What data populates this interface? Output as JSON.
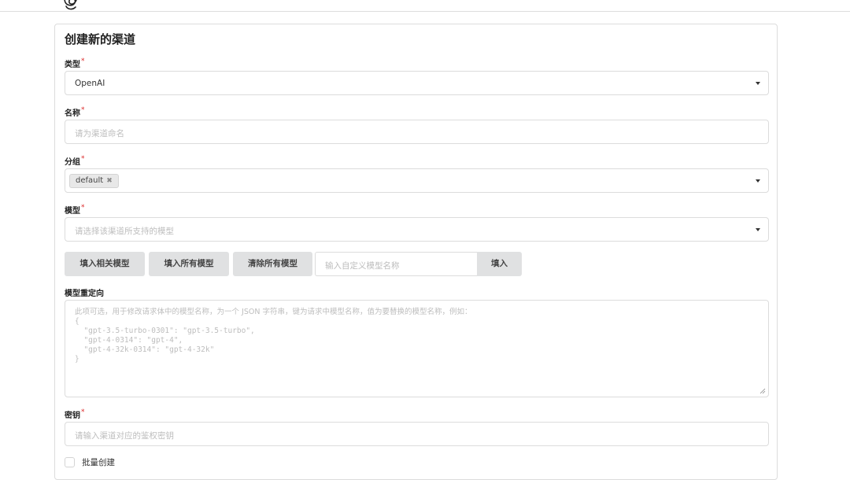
{
  "header": {
    "logo_icon": "logo-icon"
  },
  "form": {
    "title": "创建新的渠道",
    "type": {
      "label": "类型",
      "required": "*",
      "value": "OpenAI"
    },
    "name": {
      "label": "名称",
      "required": "*",
      "placeholder": "请为渠道命名"
    },
    "group": {
      "label": "分组",
      "required": "*",
      "chip": "default",
      "chip_remove": "✖"
    },
    "models": {
      "label": "模型",
      "required": "*",
      "placeholder": "请选择该渠道所支持的模型"
    },
    "model_buttons": {
      "fill_related": "填入相关模型",
      "fill_all": "填入所有模型",
      "clear_all": "清除所有模型",
      "custom_placeholder": "输入自定义模型名称",
      "fill": "填入"
    },
    "model_mapping": {
      "label": "模型重定向",
      "placeholder_line1": "此项可选，用于修改请求体中的模型名称，为一个 JSON 字符串，键为请求中模型名称，值为要替换的模型名称，例如：",
      "placeholder_rest": "{\n  \"gpt-3.5-turbo-0301\": \"gpt-3.5-turbo\",\n  \"gpt-4-0314\": \"gpt-4\",\n  \"gpt-4-32k-0314\": \"gpt-4-32k\"\n}"
    },
    "key": {
      "label": "密钥",
      "required": "*",
      "placeholder": "请输入渠道对应的鉴权密钥"
    },
    "batch_create": {
      "label": "批量创建",
      "checked": false
    }
  }
}
